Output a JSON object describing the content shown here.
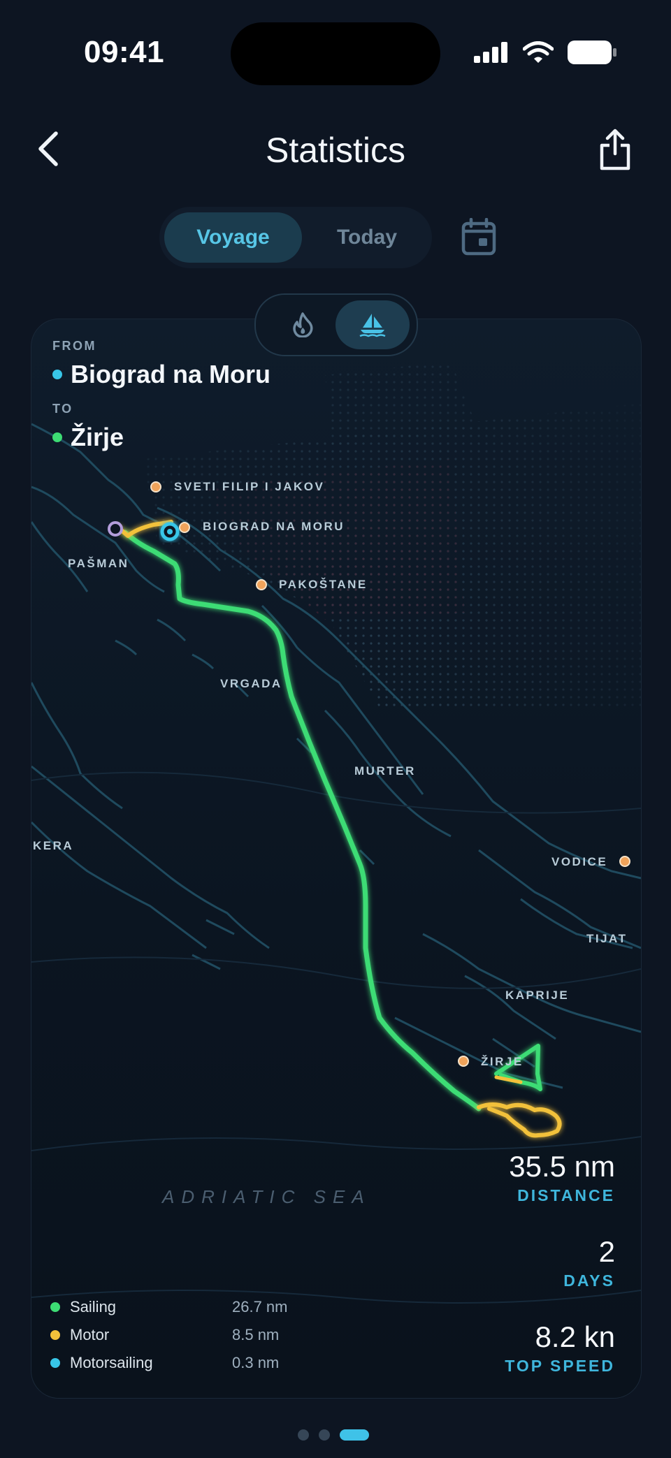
{
  "status_bar": {
    "time": "09:41"
  },
  "header": {
    "title": "Statistics"
  },
  "tabs": [
    {
      "label": "Voyage",
      "active": true
    },
    {
      "label": "Today",
      "active": false
    }
  ],
  "route": {
    "from_label": "FROM",
    "from": "Biograd na Moru",
    "to_label": "TO",
    "to": "Žirje"
  },
  "map_labels": {
    "sveti_filip": "SVETI FILIP I JAKOV",
    "biograd": "BIOGRAD NA MORU",
    "pasman": "PAŠMAN",
    "pakostane": "PAKOŠTANE",
    "vrgada": "VRGADA",
    "murter": "MURTER",
    "kera": "KERA",
    "vodice": "VODICE",
    "tijat": "TIJAT",
    "kaprije": "KAPRIJE",
    "zirje": "ŽIRJE",
    "sea": "ADRIATIC SEA"
  },
  "stats": [
    {
      "value": "35.5 nm",
      "label": "DISTANCE"
    },
    {
      "value": "2",
      "label": "DAYS"
    },
    {
      "value": "8.2 kn",
      "label": "TOP SPEED"
    }
  ],
  "legend": [
    {
      "name": "Sailing",
      "value": "26.7 nm",
      "color": "#3ddc74"
    },
    {
      "name": "Motor",
      "value": "8.5 nm",
      "color": "#f2c13b"
    },
    {
      "name": "Motorsailing",
      "value": "0.3 nm",
      "color": "#38c6e8"
    }
  ],
  "colors": {
    "accent": "#3fb6dc",
    "sailing": "#3ddc74",
    "motor": "#f2c13b",
    "motorsailing": "#38c6e8",
    "poi": "#f0a35a"
  },
  "icons": {
    "back": "chevron-left-icon",
    "share": "share-icon",
    "calendar": "calendar-icon",
    "fire": "flame-icon",
    "boat": "sailboat-icon"
  },
  "pager": {
    "pages": 3,
    "active": 3
  }
}
